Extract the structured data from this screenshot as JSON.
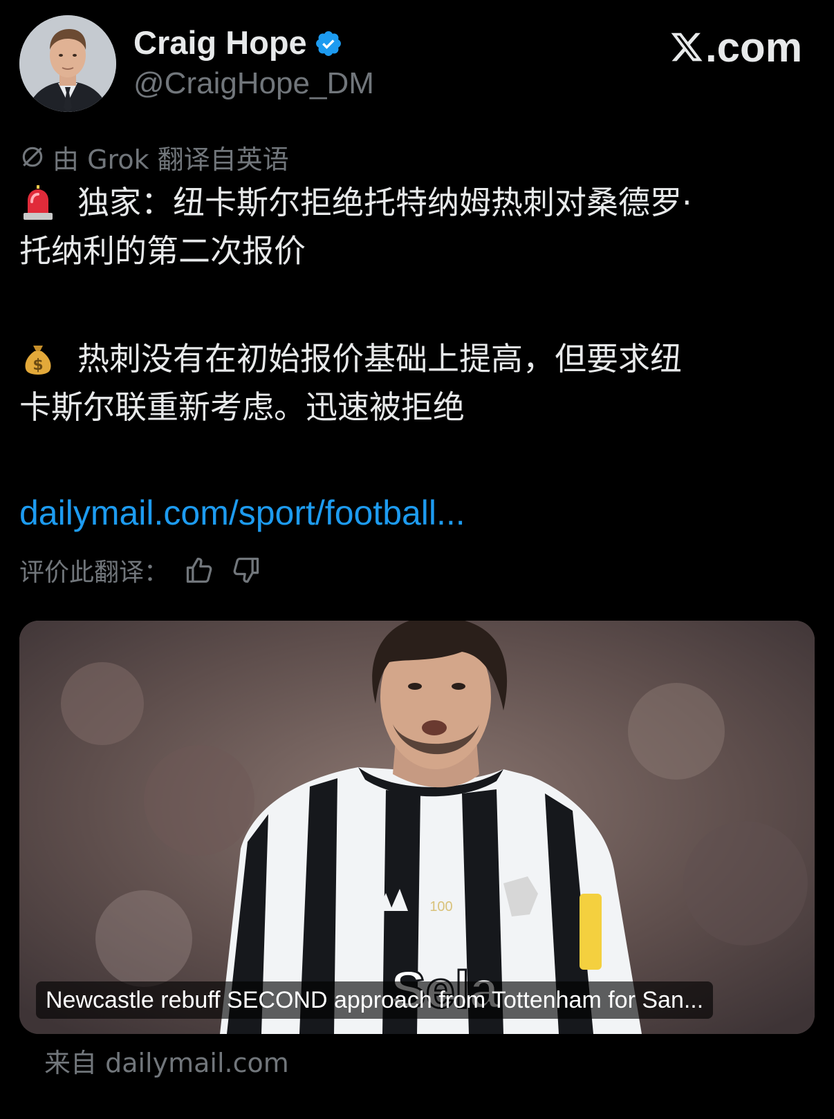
{
  "author": {
    "name": "Craig Hope",
    "handle": "@CraigHope_DM",
    "verified": true
  },
  "brand": {
    "logo_text": ".com",
    "logo_icon": "x-logo-icon"
  },
  "translation": {
    "note": "由 Grok 翻译自英语",
    "icon": "grok-icon"
  },
  "tweet": {
    "line1_emoji": "siren-emoji",
    "line1": "独家：纽卡斯尔拒绝托特纳姆热刺对桑德罗·",
    "line2": "托纳利的第二次报价",
    "line3_emoji": "money-bag-emoji",
    "line3": "热刺没有在初始报价基础上提高，但要求纽",
    "line4": "卡斯尔联重新考虑。迅速被拒绝",
    "link": "dailymail.com/sport/football..."
  },
  "rating": {
    "label": "评价此翻译：",
    "thumbs_up_icon": "thumbs-up-icon",
    "thumbs_down_icon": "thumbs-down-icon"
  },
  "card": {
    "title": "Newcastle rebuff SECOND approach from Tottenham for San...",
    "source": "来自 dailymail.com",
    "image_shirt_number": "100",
    "image_sponsor_text": "Sela"
  },
  "colors": {
    "background": "#000000",
    "text_primary": "#e7e9ea",
    "text_secondary": "#71767b",
    "link": "#1d9bf0",
    "verified": "#1d9bf0"
  }
}
